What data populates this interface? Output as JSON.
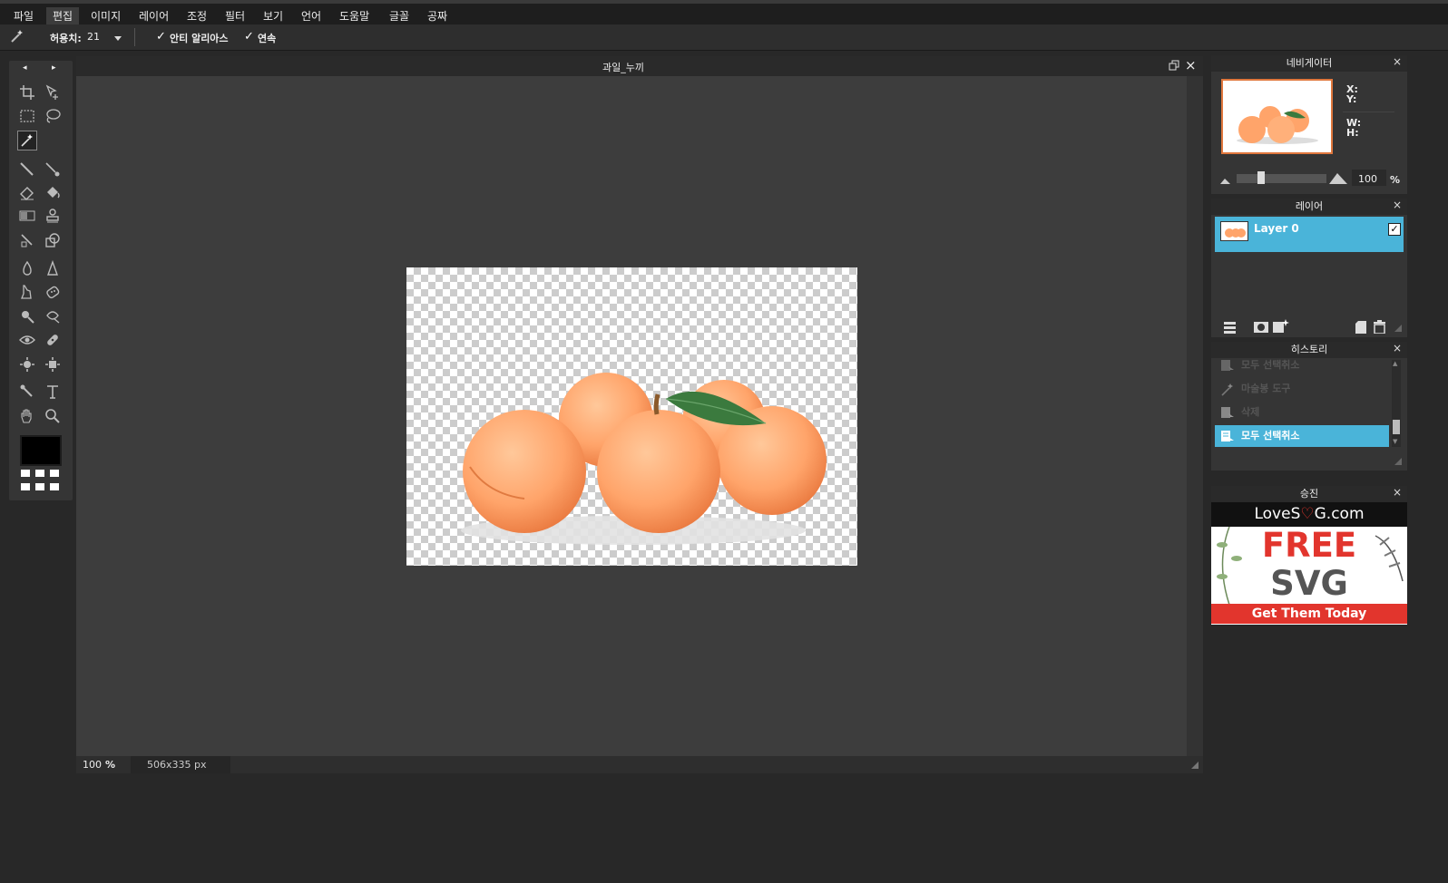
{
  "menubar": {
    "items": [
      "파일",
      "편집",
      "이미지",
      "레이어",
      "조정",
      "필터",
      "보기",
      "언어",
      "도움말",
      "글꼴",
      "공짜"
    ],
    "active": "편집"
  },
  "options": {
    "tolerance_label": "허용치:",
    "tolerance_value": "21",
    "anti_alias_label": "안티 알리아스",
    "anti_alias_checked": true,
    "contiguous_label": "연속",
    "contiguous_checked": true
  },
  "document": {
    "title": "과일_누끼",
    "zoom_value": "100",
    "zoom_unit": "%",
    "size_text": "506x335 px"
  },
  "navigator": {
    "title": "네비게이터",
    "x_label": "X:",
    "y_label": "Y:",
    "w_label": "W:",
    "h_label": "H:",
    "zoom_value": "100",
    "zoom_unit": "%",
    "slider_level": 0.25
  },
  "layers": {
    "title": "레이어",
    "items": [
      {
        "name": "Layer 0",
        "visible": true
      }
    ]
  },
  "history": {
    "title": "히스토리",
    "items": [
      {
        "label": "모두 선택취소",
        "icon": "deselect-icon",
        "active": false
      },
      {
        "label": "마술봉 도구",
        "icon": "magic-wand-icon",
        "active": false
      },
      {
        "label": "삭제",
        "icon": "delete-icon",
        "active": false
      },
      {
        "label": "모두 선택취소",
        "icon": "deselect-icon",
        "active": true
      }
    ]
  },
  "ad": {
    "title": "승진",
    "brand_pre": "LoveS",
    "brand_post": "G.com",
    "line1": "FREE",
    "line2": "SVG",
    "cta": "Get Them Today"
  },
  "colors": {
    "accent": "#4ab4d9",
    "foreground": "#000000",
    "ad_red": "#e2352d"
  },
  "close_glyph": "×"
}
